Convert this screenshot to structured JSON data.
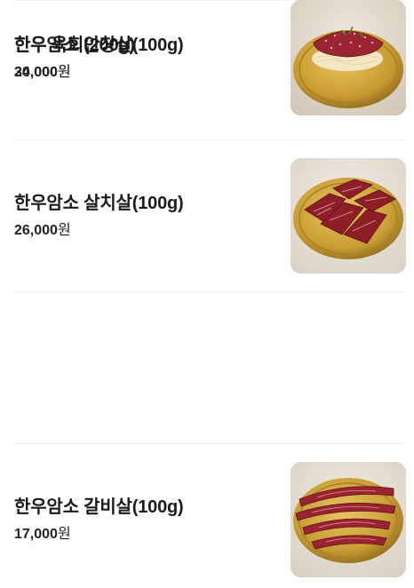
{
  "items": [
    {
      "name": "한우암소 살치살(100g)",
      "price": "26,000",
      "currency": "원",
      "image": "raw-beef-slices-on-gold-plate"
    },
    {
      "name": "한우암소 갈비살(100g)",
      "price": "17,000",
      "currency": "원",
      "image": "raw-rib-meat-strips-on-gold-plate"
    },
    {
      "name": "한우암소 안창살(100g)",
      "price": "30,000",
      "currency": "원",
      "image": "skirt-steak-on-slate-board"
    },
    {
      "name": "한우 육회(200g)",
      "price": "24,000",
      "currency": "원",
      "image": "beef-tartare-on-gold-plate"
    }
  ],
  "colors": {
    "text": "#1b1b1b",
    "divider": "#efefef",
    "plate_gold": "#c9a13b",
    "meat": "#8e1f28"
  }
}
